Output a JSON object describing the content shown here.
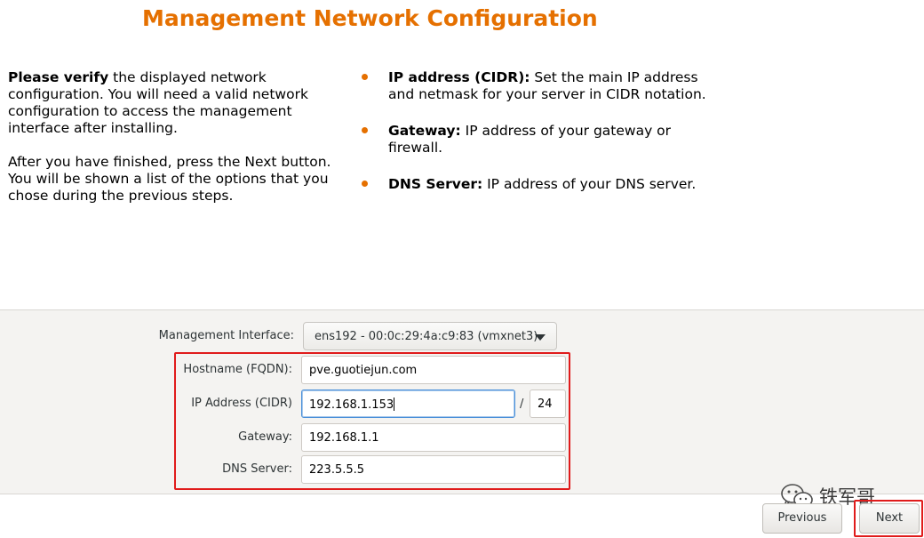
{
  "header": {
    "title": "Management Network Configuration"
  },
  "intro": {
    "p1_bold": "Please verify",
    "p1_rest": " the displayed network configuration. You will need a valid network configuration to access the management interface after installing.",
    "p2": "After you have finished, press the Next button. You will be shown a list of the options that you chose during the previous steps."
  },
  "bullets": [
    {
      "bold": "IP address (CIDR):",
      "text": " Set the main IP address and netmask for your server in CIDR notation."
    },
    {
      "bold": "Gateway:",
      "text": " IP address of your gateway or firewall."
    },
    {
      "bold": "DNS Server:",
      "text": " IP address of your DNS server."
    }
  ],
  "form": {
    "interface_label": "Management Interface:",
    "interface_value": "ens192 - 00:0c:29:4a:c9:83 (vmxnet3)",
    "hostname_label": "Hostname (FQDN):",
    "hostname_value": "pve.guotiejun.com",
    "ip_label": "IP Address (CIDR)",
    "ip_value": "192.168.1.153",
    "cidr_separator": "/",
    "cidr_value": "24",
    "gateway_label": "Gateway:",
    "gateway_value": "192.168.1.1",
    "dns_label": "DNS Server:",
    "dns_value": "223.5.5.5"
  },
  "footer": {
    "previous_label": "Previous",
    "next_label": "Next"
  },
  "watermark": {
    "text": "铁军哥",
    "icon": "wechat-icon"
  },
  "colors": {
    "accent": "#e57000",
    "highlight": "#e01b1b",
    "focus": "#4a90d9"
  }
}
